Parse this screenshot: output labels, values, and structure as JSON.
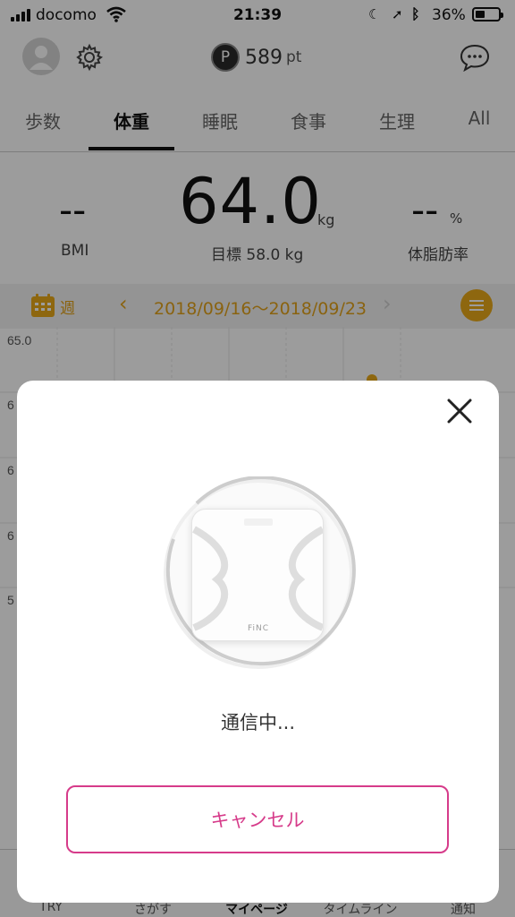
{
  "status_bar": {
    "carrier": "docomo",
    "time": "21:39",
    "battery": "36%",
    "icons": [
      "signal-icon",
      "wifi-icon",
      "moon-icon",
      "location-icon",
      "bluetooth-icon",
      "battery-icon"
    ]
  },
  "header": {
    "points_badge": "P",
    "points_value": "589",
    "points_unit": "pt",
    "icons": [
      "avatar-icon",
      "gear-icon",
      "chat-icon"
    ]
  },
  "tabs": [
    {
      "label": "歩数",
      "active": false
    },
    {
      "label": "体重",
      "active": true
    },
    {
      "label": "睡眠",
      "active": false
    },
    {
      "label": "食事",
      "active": false
    },
    {
      "label": "生理",
      "active": false
    },
    {
      "label": "All",
      "active": false
    }
  ],
  "metrics": {
    "bmi_value": "--",
    "bmi_label": "BMI",
    "weight_value": "64.0",
    "weight_unit": "kg",
    "target": "目標 58.0 kg",
    "fat_value": "--",
    "fat_unit": "%",
    "fat_label": "体脂肪率"
  },
  "period": {
    "label": "週",
    "range": "2018/09/16〜2018/09/23",
    "prev": "‹",
    "next": "›"
  },
  "chart_data": {
    "type": "line",
    "y_tick_labels": [
      "65.0",
      "6",
      "6",
      "6",
      "5"
    ],
    "visible_points": [
      {
        "day_index": 5,
        "value": 64.0
      },
      {
        "day_index": 6,
        "value": 64.5
      }
    ],
    "day_columns": 8,
    "series_color": "#e8a81a",
    "grid": true
  },
  "bottom_nav": [
    {
      "label": "TRY",
      "active": false
    },
    {
      "label": "さがす",
      "active": false
    },
    {
      "label": "マイページ",
      "active": true
    },
    {
      "label": "タイムライン",
      "active": false
    },
    {
      "label": "通知",
      "active": false
    }
  ],
  "modal": {
    "close_icon": "close-icon",
    "scale_brand": "FiNC",
    "status": "通信中...",
    "cancel_label": "キャンセル"
  },
  "colors": {
    "accent": "#e8a81a",
    "cancel": "#d63b8a",
    "overlay": "rgba(0,0,0,0.39)"
  }
}
